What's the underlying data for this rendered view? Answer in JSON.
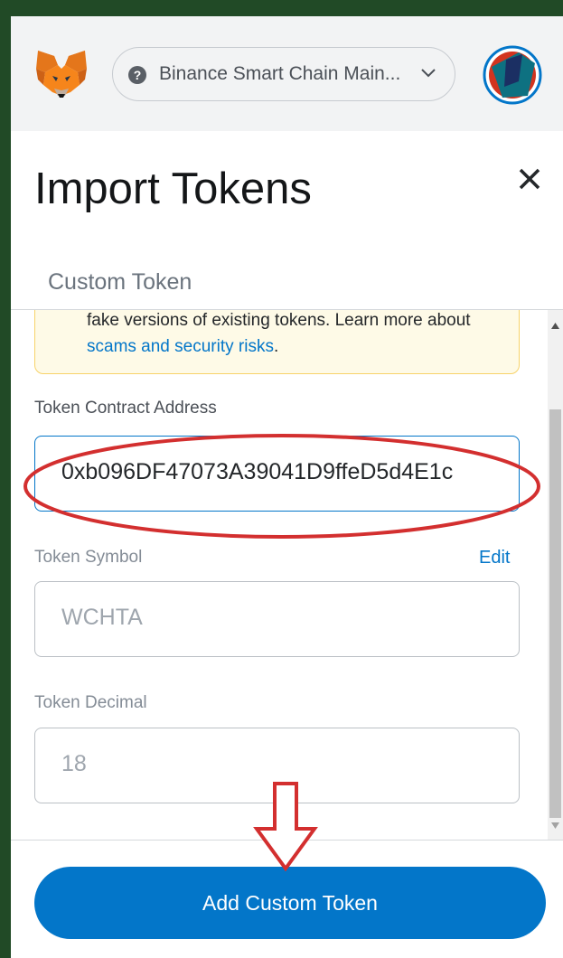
{
  "header": {
    "network_label": "Binance Smart Chain Main...",
    "network_help_glyph": "?",
    "logo_icon": "metamask-fox-icon",
    "account_icon": "account-avatar-icon"
  },
  "page": {
    "title": "Import Tokens",
    "close_icon": "close-icon",
    "tab_label": "Custom Token"
  },
  "warning": {
    "text": "fake versions of existing tokens. Learn more about ",
    "link_text": "scams and security risks",
    "suffix": "."
  },
  "form": {
    "contract_address_label": "Token Contract Address",
    "contract_address_value": "0xb096DF47073A39041D9ffeD5d4E1c",
    "symbol_label": "Token Symbol",
    "symbol_edit": "Edit",
    "symbol_value": "WCHTA",
    "decimal_label": "Token Decimal",
    "decimal_value": "18"
  },
  "footer": {
    "add_button_label": "Add Custom Token"
  },
  "colors": {
    "accent": "#0376c9",
    "annotation": "#d32f2f",
    "warning_bg": "#fefae7",
    "outer_bg": "#214a26"
  }
}
